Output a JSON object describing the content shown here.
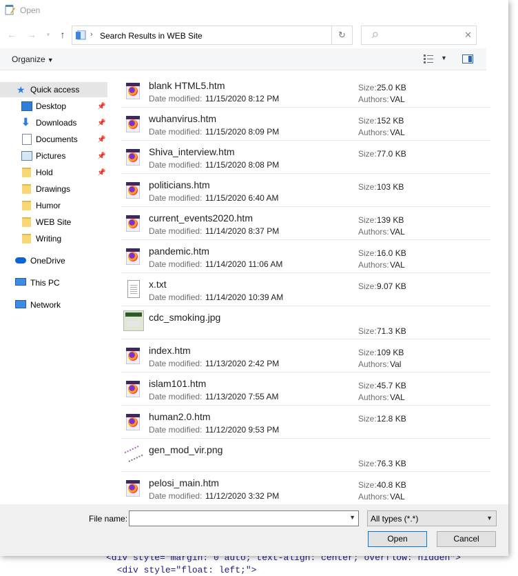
{
  "window": {
    "title": "Open"
  },
  "nav": {
    "address": "Search Results in WEB Site"
  },
  "toolbar": {
    "organize": "Organize"
  },
  "sidebar": {
    "items": [
      {
        "label": "Quick access",
        "icon": "star-icon"
      },
      {
        "label": "Desktop",
        "icon": "desktop-icon"
      },
      {
        "label": "Downloads",
        "icon": "download-icon"
      },
      {
        "label": "Documents",
        "icon": "documents-icon"
      },
      {
        "label": "Pictures",
        "icon": "pictures-icon"
      },
      {
        "label": "Hold",
        "icon": "folder-icon"
      },
      {
        "label": "Drawings",
        "icon": "folder-icon"
      },
      {
        "label": "Humor",
        "icon": "folder-icon"
      },
      {
        "label": "WEB Site",
        "icon": "folder-icon"
      },
      {
        "label": "Writing",
        "icon": "folder-icon"
      },
      {
        "label": "OneDrive",
        "icon": "cloud-icon"
      },
      {
        "label": "This PC",
        "icon": "computer-icon"
      },
      {
        "label": "Network",
        "icon": "network-icon"
      }
    ]
  },
  "list": {
    "date_label": "Date modified:",
    "size_label": "Size:",
    "authors_label": "Authors:",
    "files": [
      {
        "name": "blank HTML5.htm",
        "date": "11/15/2020 8:12 PM",
        "size": "25.0 KB",
        "authors": "VAL",
        "icon": "firefox-html-icon"
      },
      {
        "name": "wuhanvirus.htm",
        "date": "11/15/2020 8:09 PM",
        "size": "152 KB",
        "authors": "VAL",
        "icon": "firefox-html-icon"
      },
      {
        "name": "Shiva_interview.htm",
        "date": "11/15/2020 8:08 PM",
        "size": "77.0 KB",
        "authors": "",
        "icon": "firefox-html-icon"
      },
      {
        "name": "politicians.htm",
        "date": "11/15/2020 6:40 AM",
        "size": "103 KB",
        "authors": "",
        "icon": "firefox-html-icon"
      },
      {
        "name": "current_events2020.htm",
        "date": "11/14/2020 8:37 PM",
        "size": "139 KB",
        "authors": "VAL",
        "icon": "firefox-html-icon"
      },
      {
        "name": "pandemic.htm",
        "date": "11/14/2020 11:06 AM",
        "size": "16.0 KB",
        "authors": "VAL",
        "icon": "firefox-html-icon"
      },
      {
        "name": "x.txt",
        "date": "11/14/2020 10:39 AM",
        "size": "9.07 KB",
        "authors": "",
        "icon": "text-file-icon"
      },
      {
        "name": "cdc_smoking.jpg",
        "date": "",
        "size": "71.3 KB",
        "authors": "",
        "icon": "jpg-thumbnail-icon"
      },
      {
        "name": "index.htm",
        "date": "11/13/2020 2:42 PM",
        "size": "109 KB",
        "authors": "Val",
        "icon": "firefox-html-icon"
      },
      {
        "name": "islam101.htm",
        "date": "11/13/2020 7:55 AM",
        "size": "45.7 KB",
        "authors": "VAL",
        "icon": "firefox-html-icon"
      },
      {
        "name": "human2.0.htm",
        "date": "11/12/2020 9:53 PM",
        "size": "12.8 KB",
        "authors": "",
        "icon": "firefox-html-icon"
      },
      {
        "name": "gen_mod_vir.png",
        "date": "",
        "size": "76.3 KB",
        "authors": "",
        "icon": "png-thumbnail-icon"
      },
      {
        "name": "pelosi_main.htm",
        "date": "11/12/2020 3:32 PM",
        "size": "40.8 KB",
        "authors": "VAL",
        "icon": "firefox-html-icon"
      }
    ]
  },
  "footer": {
    "file_name_label": "File name:",
    "file_name_value": "",
    "file_type": "All types (*.*)",
    "open_label": "Open",
    "cancel_label": "Cancel"
  },
  "background_code": {
    "line1": "<div style=\"margin: 0 auto; text-align: center; overflow: hidden\">",
    "line2": "  <div style=\"float: left;\">"
  }
}
